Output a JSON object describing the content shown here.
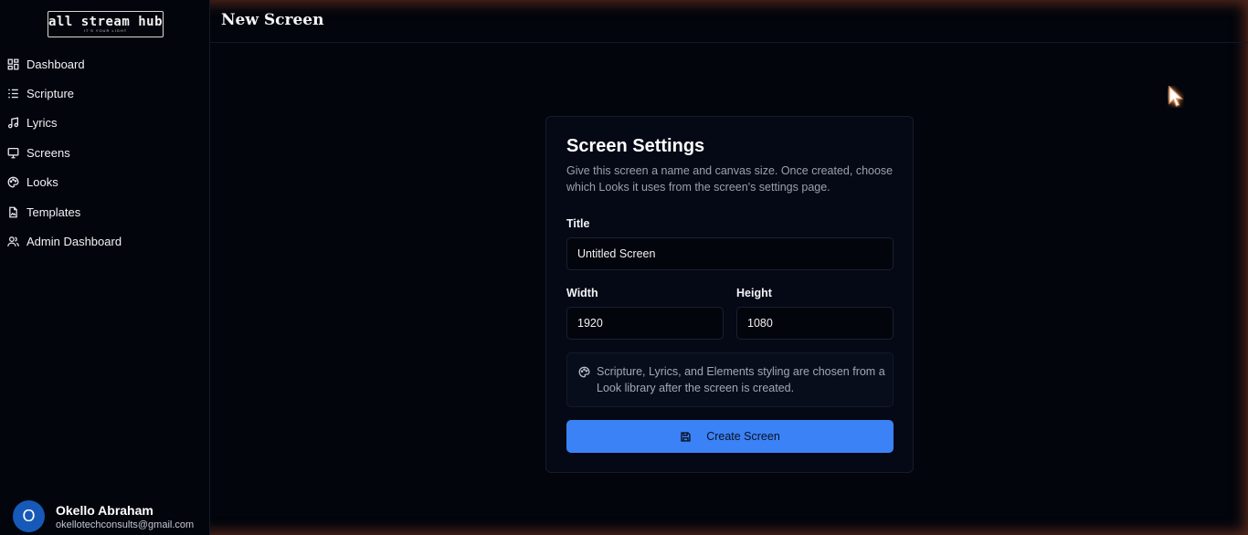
{
  "logo": {
    "main": "all stream hub",
    "tagline": "IT'S YOUR LIGHT"
  },
  "sidebar": {
    "items": [
      {
        "label": "Dashboard",
        "icon": "dashboard-icon"
      },
      {
        "label": "Scripture",
        "icon": "list-icon"
      },
      {
        "label": "Lyrics",
        "icon": "music-note-icon"
      },
      {
        "label": "Screens",
        "icon": "monitor-icon"
      },
      {
        "label": "Looks",
        "icon": "palette-icon"
      },
      {
        "label": "Templates",
        "icon": "file-image-icon"
      },
      {
        "label": "Admin Dashboard",
        "icon": "users-icon"
      }
    ]
  },
  "user": {
    "initial": "O",
    "name": "Okello Abraham",
    "email": "okellotechconsults@gmail.com"
  },
  "header": {
    "title": "New Screen"
  },
  "card": {
    "title": "Screen Settings",
    "description": "Give this screen a name and canvas size. Once created, choose which Looks it uses from the screen's settings page.",
    "title_label": "Title",
    "title_value": "Untitled Screen",
    "width_label": "Width",
    "width_value": "1920",
    "height_label": "Height",
    "height_value": "1080",
    "info_text": "Scripture, Lyrics, and Elements styling are chosen from a Look library after the screen is created.",
    "create_label": "Create Screen"
  },
  "colors": {
    "accent": "#3b82f6",
    "background": "#03050c",
    "avatar": "#1659b8"
  }
}
